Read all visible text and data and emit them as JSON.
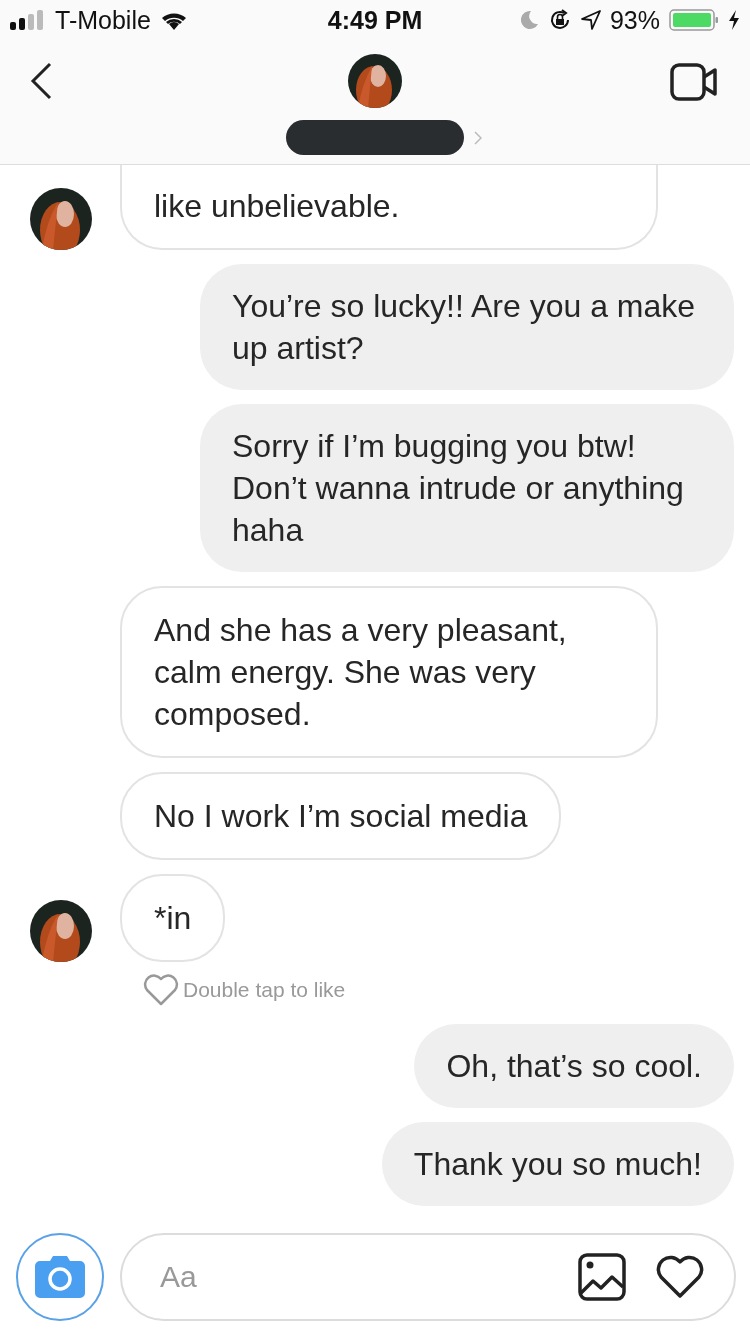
{
  "status_bar": {
    "carrier": "T-Mobile",
    "time": "4:49 PM",
    "battery": "93%"
  },
  "header": {
    "name_redacted": true
  },
  "messages": [
    {
      "kind": "message",
      "outgoing": false,
      "text": "like unbelievable.",
      "avatar": true,
      "cut": true
    },
    {
      "kind": "message",
      "outgoing": true,
      "text": "You’re so lucky!! Are you a make up artist?",
      "cut": false
    },
    {
      "kind": "message",
      "outgoing": true,
      "text": "Sorry if I’m bugging you btw! Don’t wanna intrude or anything haha",
      "cut": false
    },
    {
      "kind": "message",
      "outgoing": false,
      "text": "And she has a very pleasant, calm energy. She was very composed.",
      "avatar": false,
      "cut": false
    },
    {
      "kind": "message",
      "outgoing": false,
      "text": "No I work I’m social media",
      "avatar": false,
      "cut": false
    },
    {
      "kind": "message",
      "outgoing": false,
      "text": "*in",
      "avatar": true,
      "cut": false
    },
    {
      "kind": "like_hint",
      "text": "Double tap to like"
    },
    {
      "kind": "message",
      "outgoing": true,
      "text": "Oh, that’s so cool.",
      "cut": false
    },
    {
      "kind": "message",
      "outgoing": true,
      "text": "Thank you so much!",
      "cut": false
    }
  ],
  "composer": {
    "placeholder": "Aa"
  }
}
